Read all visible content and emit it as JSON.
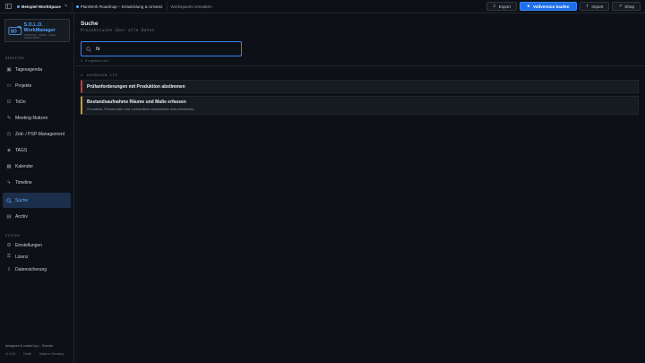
{
  "topbar": {
    "workspace": "Beispiel WorkSpace",
    "project": "PlanWerk Roadmap – Entwicklung & Umsetz",
    "manage_link": "Workspaces verwalten",
    "export_label": "Export",
    "buy_label": "Vollversion kaufen",
    "import_label": "Import",
    "shop_label": "Shop"
  },
  "logo": {
    "title": "S.O.L.O. WorkManager",
    "subtitle": "STRUKTUR · OFFEN · LOKAL · ORGANISIERT"
  },
  "sidebar": {
    "section_main": "BEREICHE",
    "items": [
      {
        "label": "Tagesagenda",
        "icon": "calendar-day-icon"
      },
      {
        "label": "Projekte",
        "icon": "folder-icon"
      },
      {
        "label": "ToDo",
        "icon": "check-icon"
      },
      {
        "label": "Meeting-Notizen",
        "icon": "pen-icon"
      },
      {
        "label": "Zeit- / PSP-Management",
        "icon": "clock-icon"
      },
      {
        "label": "TAGS",
        "icon": "tag-icon"
      },
      {
        "label": "Kalender",
        "icon": "calendar-icon"
      },
      {
        "label": "Timeline",
        "icon": "timeline-icon"
      },
      {
        "label": "Suche",
        "icon": "search-icon"
      },
      {
        "label": "Archiv",
        "icon": "archive-icon"
      }
    ],
    "section_system": "SYSTEM",
    "system_items": [
      {
        "label": "Einstellungen",
        "icon": "gear-icon"
      },
      {
        "label": "Lizenz",
        "icon": "key-icon"
      },
      {
        "label": "Datensicherung",
        "icon": "download-icon"
      }
    ],
    "footer": "designed & coded by L. Schultz",
    "footer_version": "v1.0.00",
    "footer_a": "Detail",
    "footer_b": "Made in Germany"
  },
  "main": {
    "title": "Suche",
    "subtitle": "Projektsuche über alle Daten",
    "search_value": "fä",
    "results_count": "2 Ergebnisse",
    "group_label": "AUSBAUEN LEI",
    "results": [
      {
        "title": "Prüfanforderungen mit Produktion abstimmen",
        "desc": "",
        "accent": "#da3633"
      },
      {
        "title": "Bestandsaufnahme Räume und Maße erfassen",
        "desc": "Grundriss, Raummaße und vorhandene Anschlüsse dokumentieren.",
        "accent": "#d29922"
      }
    ]
  },
  "colors": {
    "accent": "#1f6feb",
    "active_bg": "#1c2f4a",
    "bg": "#0d1117"
  }
}
